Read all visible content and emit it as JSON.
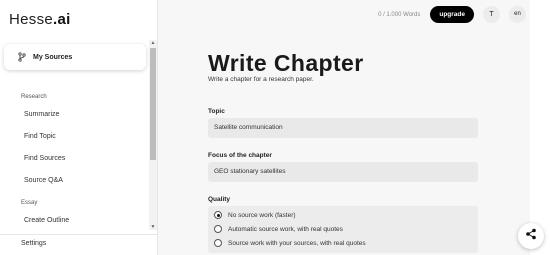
{
  "app": {
    "logo_main": "Hesse",
    "logo_suffix": ".ai"
  },
  "sidebar": {
    "my_sources_label": "My Sources",
    "sections": [
      {
        "title": "Research",
        "items": [
          "Summarize",
          "Find Topic",
          "Find Sources",
          "Source Q&A"
        ]
      },
      {
        "title": "Essay",
        "items": [
          "Create Outline"
        ]
      }
    ],
    "settings_label": "Settings"
  },
  "topbar": {
    "word_count": "0 / 1.000 Words",
    "upgrade_label": "upgrade",
    "user_initial": "T",
    "language": "en"
  },
  "page": {
    "title": "Write Chapter",
    "subtitle": "Write a chapter for a research paper."
  },
  "form": {
    "topic_label": "Topic",
    "topic_value": "Satellite communication",
    "focus_label": "Focus of the chapter",
    "focus_value": "GEO stationary satellites",
    "quality_label": "Quality",
    "quality_options": [
      {
        "label": "No source work (faster)",
        "selected": true
      },
      {
        "label": "Automatic source work, with real quotes",
        "selected": false
      },
      {
        "label": "Source work with your sources, with real quotes",
        "selected": false
      }
    ]
  },
  "icons": {
    "sources": "branch-icon",
    "share": "share-icon"
  },
  "colors": {
    "accent": "#000000",
    "field_bg": "#e9e9e9",
    "main_bg": "#f7f7f7"
  }
}
